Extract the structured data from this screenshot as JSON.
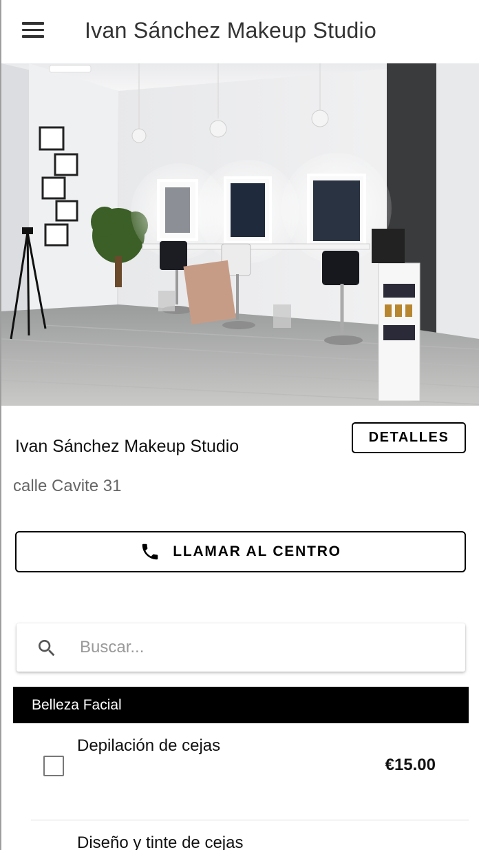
{
  "app_bar": {
    "title": "Ivan Sánchez Makeup Studio",
    "menu_icon": "hamburger-menu-icon"
  },
  "studio": {
    "name": "Ivan Sánchez Makeup Studio",
    "address": "calle Cavite 31",
    "details_label": "DETALLES",
    "call_label": "LLAMAR AL CENTRO",
    "call_icon": "phone-icon"
  },
  "search": {
    "placeholder": "Buscar...",
    "value": "",
    "icon": "search-icon"
  },
  "categories": [
    {
      "name": "Belleza Facial",
      "services": [
        {
          "name": "Depilación de cejas",
          "price": "€15.00",
          "checked": false
        },
        {
          "name": "Diseño y tinte de cejas"
        }
      ]
    }
  ],
  "colors": {
    "category_bg": "#000000",
    "text_primary": "#111111",
    "text_secondary": "#666666"
  }
}
